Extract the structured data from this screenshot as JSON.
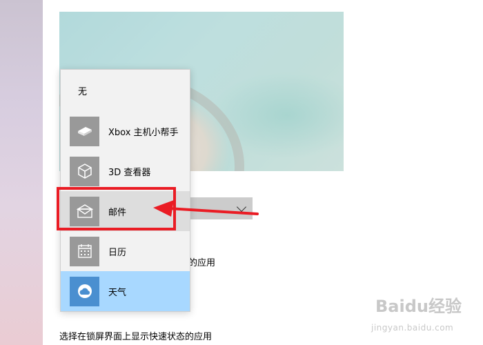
{
  "background": {
    "dropdown_chevron": "⌄",
    "app_text_partial": "态的应用",
    "quick_status_text": "选择在锁屏界面上显示快速状态的应用"
  },
  "popup": {
    "none_label": "无",
    "items": [
      {
        "label": "Xbox 主机小帮手",
        "icon": "xbox-console-icon"
      },
      {
        "label": "3D 查看器",
        "icon": "cube-3d-icon"
      },
      {
        "label": "邮件",
        "icon": "mail-envelope-icon"
      },
      {
        "label": "日历",
        "icon": "calendar-icon"
      },
      {
        "label": "天气",
        "icon": "weather-icon"
      }
    ],
    "highlighted_index": 2,
    "selected_index": 4
  },
  "annotation": {
    "color": "#ea1c24"
  },
  "watermark": {
    "brand": "Baidu经验",
    "url": "jingyan.baidu.com"
  },
  "colors": {
    "selected": "#a8d8ff",
    "selected_icon": "#4a8fd0",
    "hover": "#dddddd",
    "icon_bg": "#999999"
  }
}
